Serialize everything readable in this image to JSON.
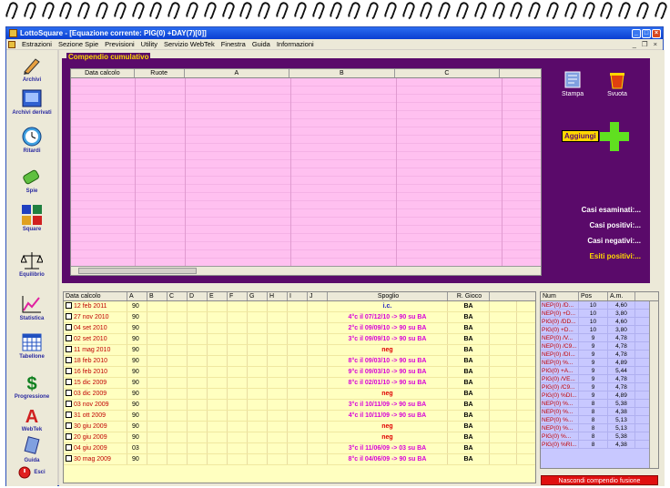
{
  "window": {
    "title": "LottoSquare - [Equazione corrente: PIG(0) +DAY(7)[0]]",
    "minimize": "_",
    "maximize": "□",
    "close": "×"
  },
  "menu": [
    "Estrazioni",
    "Sezione Spie",
    "Previsioni",
    "Utility",
    "Servizio WebTek",
    "Finestra",
    "Guida",
    "Informazioni"
  ],
  "mdi": {
    "min": "_",
    "restore": "❐",
    "close": "×"
  },
  "toolbar": [
    {
      "label": "Archivi",
      "icon": "pencil-icon"
    },
    {
      "label": "Archivi derivati",
      "icon": "book-icon"
    },
    {
      "label": "Ritardi",
      "icon": "clock-icon"
    },
    {
      "label": "Spie",
      "icon": "spyglass-icon"
    },
    {
      "label": "Square",
      "icon": "squares-icon"
    },
    {
      "label": "Equilibrio",
      "icon": "scale-icon"
    },
    {
      "label": "Statistica",
      "icon": "chart-icon"
    },
    {
      "label": "Tabellone",
      "icon": "table-icon"
    },
    {
      "label": "Progressione",
      "icon": "dollar-icon"
    },
    {
      "label": "WebTek",
      "icon": "webtek-icon"
    },
    {
      "label": "Guida",
      "icon": "guide-icon"
    },
    {
      "label": "Esci",
      "icon": "exit-icon"
    }
  ],
  "compendio": {
    "title": "Compendio cumulativo",
    "headers": [
      "Data calcolo",
      "Ruote",
      "A",
      "B",
      "C"
    ],
    "stampa": "Stampa",
    "svuota": "Svuota",
    "aggiungi": "Aggiungi",
    "casi_esaminati": "Casi esaminati:...",
    "casi_positivi": "Casi positivi:...",
    "casi_negativi": "Casi negativi:...",
    "esiti_positivi": "Esiti positivi:..."
  },
  "main_table": {
    "headers": [
      "Data calcolo",
      "A",
      "B",
      "C",
      "D",
      "E",
      "F",
      "G",
      "H",
      "I",
      "J",
      "Spoglio",
      "R. Gioco"
    ],
    "rows": [
      {
        "date": "12 feb 2011",
        "a": "90",
        "spoglio": "i.c.",
        "type": "ic",
        "rg": "BA"
      },
      {
        "date": "27 nov 2010",
        "a": "90",
        "spoglio": "4°c il 07/12/10 -> 90 su BA",
        "type": "pos",
        "rg": "BA"
      },
      {
        "date": "04 set 2010",
        "a": "90",
        "spoglio": "2°c il 09/09/10 -> 90 su BA",
        "type": "pos",
        "rg": "BA"
      },
      {
        "date": "02 set 2010",
        "a": "90",
        "spoglio": "3°c il 09/09/10 -> 90 su BA",
        "type": "pos",
        "rg": "BA"
      },
      {
        "date": "11 mag 2010",
        "a": "90",
        "spoglio": "neg",
        "type": "neg",
        "rg": "BA"
      },
      {
        "date": "18 feb 2010",
        "a": "90",
        "spoglio": "8°c il 09/03/10 -> 90 su BA",
        "type": "pos",
        "rg": "BA"
      },
      {
        "date": "16 feb 2010",
        "a": "90",
        "spoglio": "9°c il 09/03/10 -> 90 su BA",
        "type": "pos",
        "rg": "BA"
      },
      {
        "date": "15 dic 2009",
        "a": "90",
        "spoglio": "8°c il 02/01/10 -> 90 su BA",
        "type": "pos",
        "rg": "BA"
      },
      {
        "date": "03 dic 2009",
        "a": "90",
        "spoglio": "neg",
        "type": "neg",
        "rg": "BA"
      },
      {
        "date": "03 nov 2009",
        "a": "90",
        "spoglio": "3°c il 10/11/09 -> 90 su BA",
        "type": "pos",
        "rg": "BA"
      },
      {
        "date": "31 ott 2009",
        "a": "90",
        "spoglio": "4°c il 10/11/09 -> 90 su BA",
        "type": "pos",
        "rg": "BA"
      },
      {
        "date": "30 giu 2009",
        "a": "90",
        "spoglio": "neg",
        "type": "neg",
        "rg": "BA"
      },
      {
        "date": "20 giu 2009",
        "a": "90",
        "spoglio": "neg",
        "type": "neg",
        "rg": "BA"
      },
      {
        "date": "04 giu 2009",
        "a": "03",
        "spoglio": "3°c il 11/06/09 -> 03 su BA",
        "type": "pos",
        "rg": "BA"
      },
      {
        "date": "30 mag 2009",
        "a": "90",
        "spoglio": "8°c il 04/06/09 -> 90 su BA",
        "type": "pos",
        "rg": "BA"
      }
    ]
  },
  "right_table": {
    "headers": [
      "Num",
      "Pos",
      "A.m."
    ],
    "rows": [
      [
        "NEP(0) /D...",
        "10",
        "4,60"
      ],
      [
        "NEP(0) +D...",
        "10",
        "3,80"
      ],
      [
        "PIG(0) /DD...",
        "10",
        "4,60"
      ],
      [
        "PIG(0) +D...",
        "10",
        "3,80"
      ],
      [
        "NEP(0) /V...",
        "9",
        "4,78"
      ],
      [
        "NEP(0) /C9...",
        "9",
        "4,78"
      ],
      [
        "NEP(0) /DI...",
        "9",
        "4,78"
      ],
      [
        "NEP(0) %...",
        "9",
        "4,89"
      ],
      [
        "PIG(0) +A...",
        "9",
        "5,44"
      ],
      [
        "PIG(0) /VE...",
        "9",
        "4,78"
      ],
      [
        "PIG(0) /C9...",
        "9",
        "4,78"
      ],
      [
        "PIG(0) %DI...",
        "9",
        "4,89"
      ],
      [
        "NEP(0) %...",
        "8",
        "5,38"
      ],
      [
        "NEP(0) %...",
        "8",
        "4,38"
      ],
      [
        "NEP(0) %...",
        "8",
        "5,13"
      ],
      [
        "NEP(0) %...",
        "8",
        "5,13"
      ],
      [
        "PIG(0) %...",
        "8",
        "5,38"
      ],
      [
        "PIG(0) %RI...",
        "8",
        "4,38"
      ]
    ],
    "button": "Nascondi compendio fusione"
  }
}
